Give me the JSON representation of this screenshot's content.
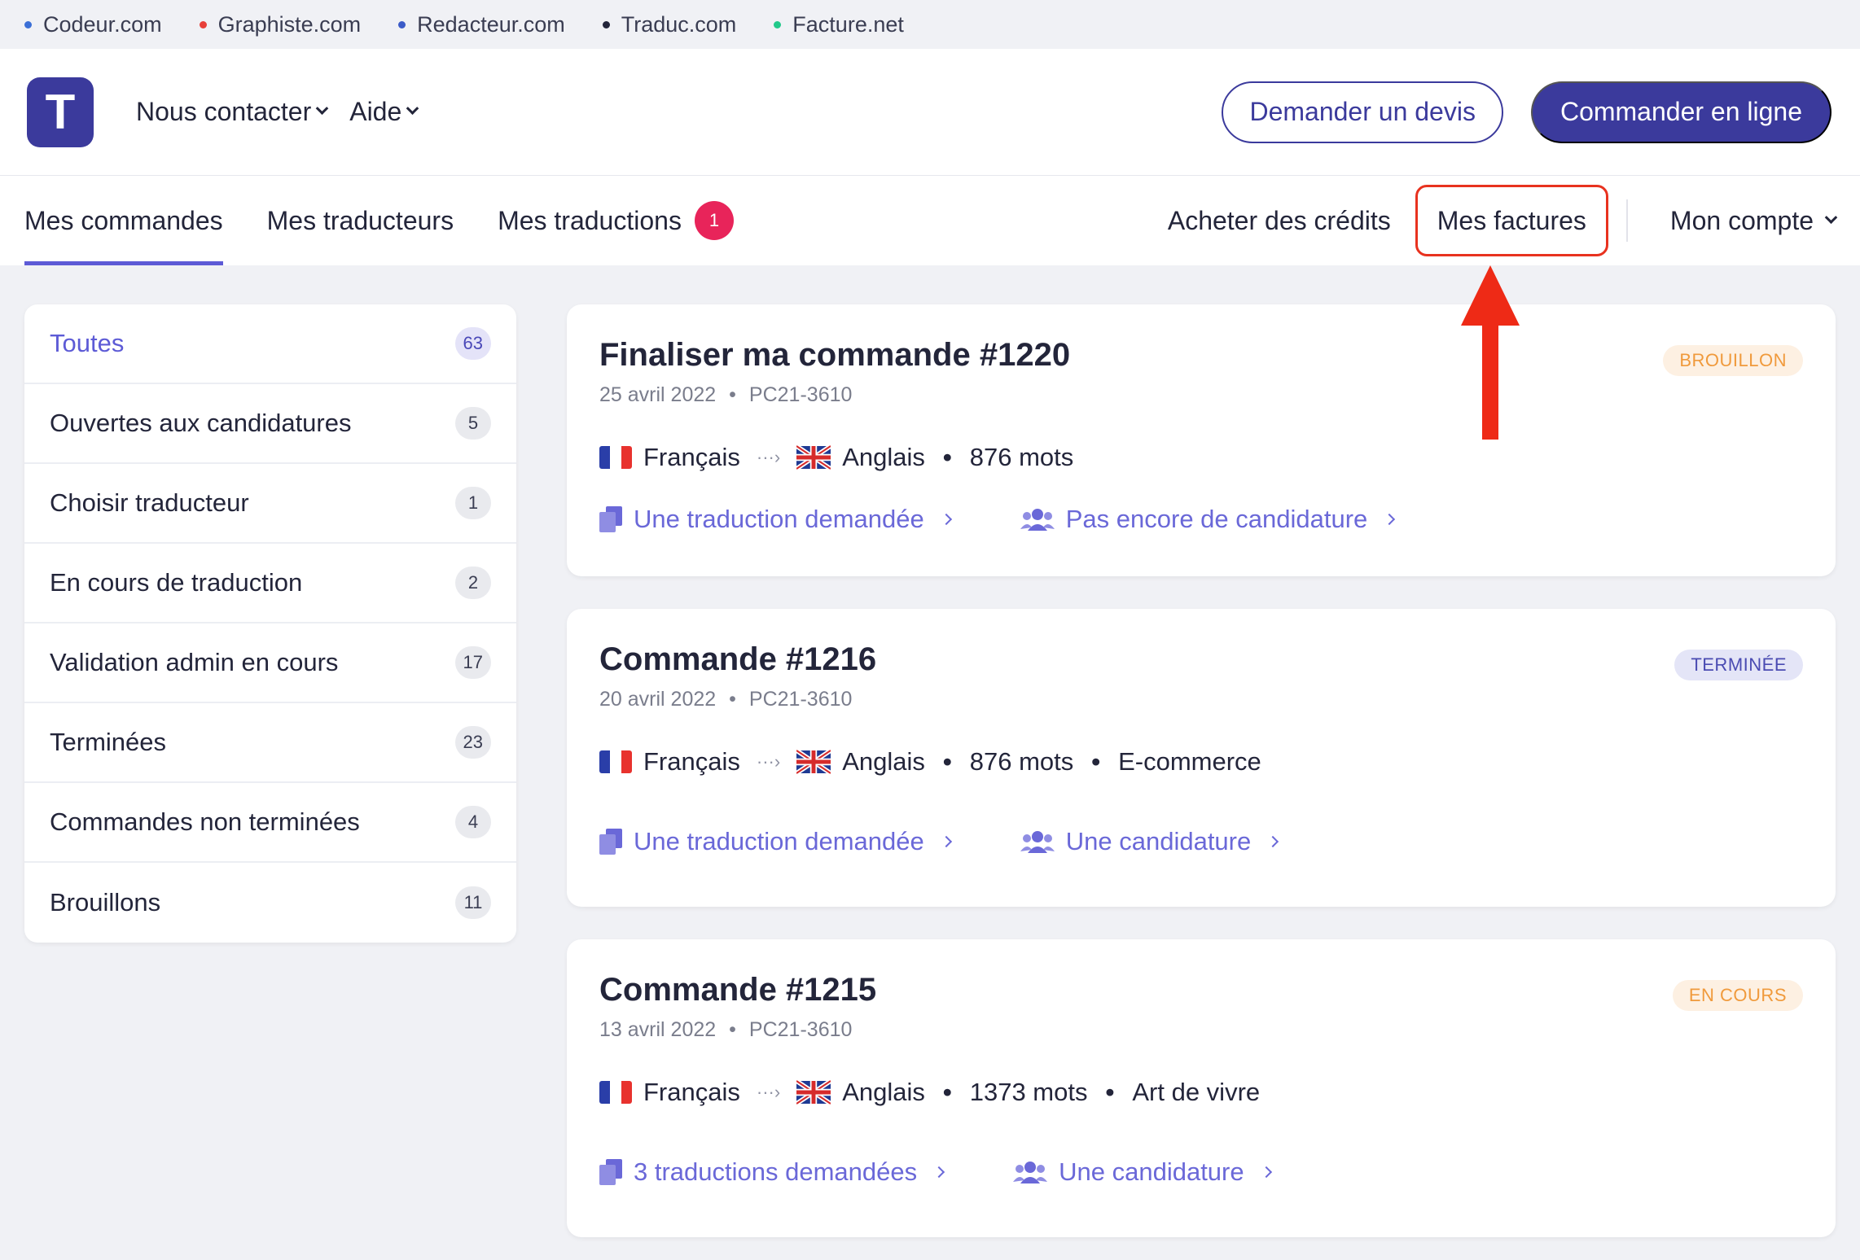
{
  "netbar": {
    "sites": [
      {
        "label": "Codeur.com",
        "color": "#3b6fd6"
      },
      {
        "label": "Graphiste.com",
        "color": "#e8403a"
      },
      {
        "label": "Redacteur.com",
        "color": "#3b5bc8"
      },
      {
        "label": "Traduc.com",
        "color": "#23253a"
      },
      {
        "label": "Facture.net",
        "color": "#22c98a"
      }
    ]
  },
  "header": {
    "logo": "T",
    "nav": [
      "Nous contacter",
      "Aide"
    ],
    "quote_button": "Demander un devis",
    "order_button": "Commander en ligne"
  },
  "subnav": {
    "tabs": [
      "Mes commandes",
      "Mes traducteurs",
      "Mes traductions"
    ],
    "translations_badge": "1",
    "buy_credits": "Acheter des crédits",
    "invoices": "Mes factures",
    "account": "Mon compte"
  },
  "sidebar": {
    "items": [
      {
        "label": "Toutes",
        "count": "63"
      },
      {
        "label": "Ouvertes aux candidatures",
        "count": "5"
      },
      {
        "label": "Choisir traducteur",
        "count": "1"
      },
      {
        "label": "En cours de traduction",
        "count": "2"
      },
      {
        "label": "Validation admin en cours",
        "count": "17"
      },
      {
        "label": "Terminées",
        "count": "23"
      },
      {
        "label": "Commandes non terminées",
        "count": "4"
      },
      {
        "label": "Brouillons",
        "count": "11"
      }
    ]
  },
  "orders": [
    {
      "title": "Finaliser ma commande #1220",
      "date": "25 avril 2022",
      "ref": "PC21-3610",
      "status": "BROUILLON",
      "source_lang": "Français",
      "target_lang": "Anglais",
      "words": "876 mots",
      "domain": "",
      "translations_link": "Une traduction demandée",
      "candidates_link": "Pas encore de candidature"
    },
    {
      "title": "Commande #1216",
      "date": "20 avril 2022",
      "ref": "PC21-3610",
      "status": "TERMINÉE",
      "source_lang": "Français",
      "target_lang": "Anglais",
      "words": "876 mots",
      "domain": "E-commerce",
      "translations_link": "Une traduction demandée",
      "candidates_link": "Une candidature"
    },
    {
      "title": "Commande #1215",
      "date": "13 avril 2022",
      "ref": "PC21-3610",
      "status": "EN COURS",
      "source_lang": "Français",
      "target_lang": "Anglais",
      "words": "1373 mots",
      "domain": "Art de vivre",
      "translations_link": "3 traductions demandées",
      "candidates_link": "Une candidature"
    }
  ],
  "colors": {
    "brand": "#3b3a9c",
    "accent": "#5d5bd6",
    "link": "#6a68d8",
    "highlight": "#e8321f",
    "badge": "#e8245a"
  }
}
